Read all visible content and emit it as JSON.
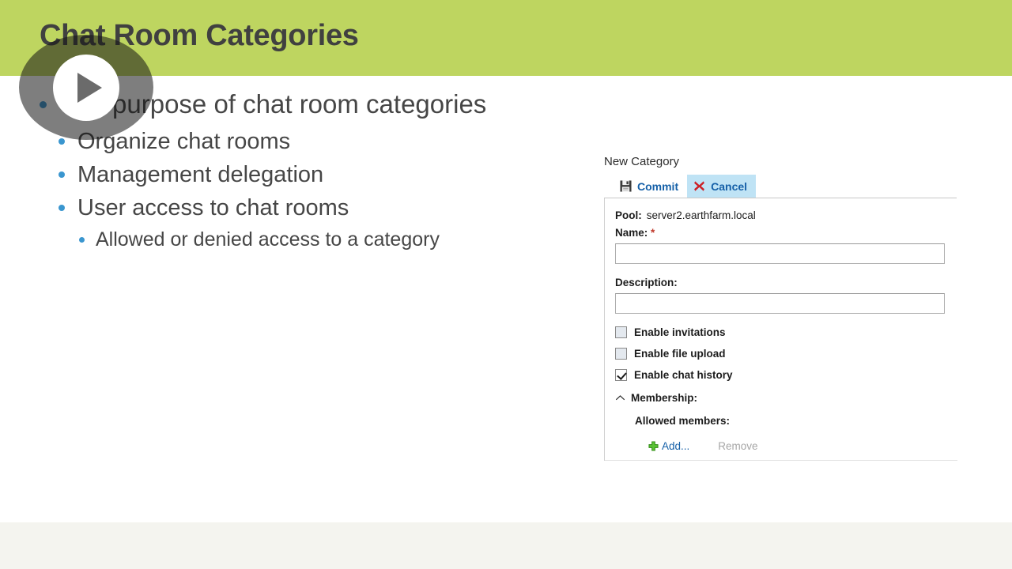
{
  "slide": {
    "title": "Chat Room Categories",
    "header_color": "#bed560",
    "title_color": "#404040",
    "bullet_color": "#3a96cf",
    "bullets": [
      {
        "level": 1,
        "text": "The purpose of chat room categories"
      },
      {
        "level": 2,
        "text": "Organize chat rooms"
      },
      {
        "level": 2,
        "text": "Management delegation"
      },
      {
        "level": 2,
        "text": "User access to chat rooms"
      },
      {
        "level": 3,
        "text": "Allowed or denied access to a category"
      }
    ]
  },
  "video_overlay": {
    "play_icon": "play-triangle-icon",
    "state": "paused"
  },
  "panel": {
    "caption": "New Category",
    "toolbar": {
      "commit_label": "Commit",
      "commit_icon": "save-floppy-icon",
      "cancel_label": "Cancel",
      "cancel_icon": "red-x-icon",
      "highlight_color": "#bfe3f5",
      "link_color": "#1560a8"
    },
    "pool": {
      "label": "Pool:",
      "value": "server2.earthfarm.local"
    },
    "name_field": {
      "label": "Name:",
      "required_marker": "*",
      "value": "",
      "placeholder": ""
    },
    "description_field": {
      "label": "Description:",
      "value": "",
      "placeholder": ""
    },
    "checkboxes": [
      {
        "label": "Enable invitations",
        "checked": false
      },
      {
        "label": "Enable file upload",
        "checked": false
      },
      {
        "label": "Enable chat history",
        "checked": true
      }
    ],
    "membership": {
      "label": "Membership:",
      "chevron": "chevron-up-icon",
      "expanded": true,
      "allowed_members_label": "Allowed members:",
      "add_label": "Add...",
      "add_icon": "green-plus-icon",
      "remove_label": "Remove",
      "remove_enabled": false
    }
  },
  "footer": {
    "band_color": "#f4f4ef"
  }
}
